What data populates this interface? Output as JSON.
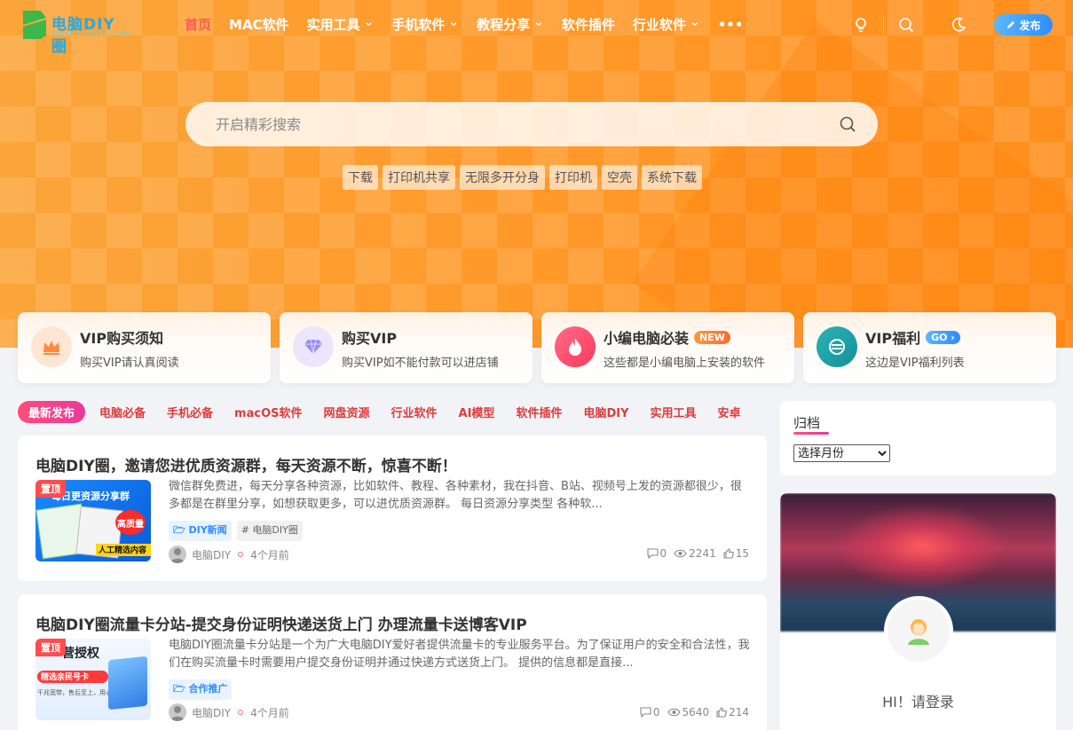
{
  "brand": {
    "name": "电脑DIY圈",
    "tagline": "WWW.DIYQUAN.COM",
    "green": "#3cb84a",
    "blue": "#2aa9e0"
  },
  "nav": {
    "items": [
      {
        "label": "首页",
        "active": true,
        "dropdown": false
      },
      {
        "label": "MAC软件",
        "active": false,
        "dropdown": false
      },
      {
        "label": "实用工具",
        "active": false,
        "dropdown": true
      },
      {
        "label": "手机软件",
        "active": false,
        "dropdown": true
      },
      {
        "label": "教程分享",
        "active": false,
        "dropdown": true
      },
      {
        "label": "软件插件",
        "active": false,
        "dropdown": false
      },
      {
        "label": "行业软件",
        "active": false,
        "dropdown": true
      },
      {
        "label": "•••",
        "active": false,
        "dropdown": false
      }
    ],
    "icons": [
      "bulb-icon",
      "search-icon",
      "moon-icon"
    ],
    "publish_label": "发布",
    "active_color": "#ff5a5a"
  },
  "search": {
    "placeholder": "开启精彩搜索",
    "hot_tags": [
      "下载",
      "打印机共享",
      "无限多开分身",
      "打印机",
      "空壳",
      "系统下载"
    ]
  },
  "features": [
    {
      "title": "VIP购买须知",
      "desc": "购买VIP请认真阅读",
      "icon": "crown-icon",
      "badge": ""
    },
    {
      "title": "购买VIP",
      "desc": "购买VIP如不能付款可以进店铺",
      "icon": "diamond-icon",
      "badge": ""
    },
    {
      "title": "小编电脑必装",
      "desc": "这些都是小编电脑上安装的软件",
      "icon": "flame-icon",
      "badge": "NEW"
    },
    {
      "title": "VIP福利",
      "desc": "这边是VIP福利列表",
      "icon": "gift-icon",
      "badge": "GO"
    }
  ],
  "categories": [
    "最新发布",
    "电脑必备",
    "手机必备",
    "macOS软件",
    "网盘资源",
    "行业软件",
    "AI模型",
    "软件插件",
    "电脑DIY",
    "实用工具",
    "安卓"
  ],
  "posts": [
    {
      "title": "电脑DIY圈，邀请您进优质资源群，每天资源不断，惊喜不断！",
      "pin": "置顶",
      "thumb_text": "每日更资源分享群",
      "thumb_badge": "高质量",
      "thumb_footer": "人工精选内容",
      "excerpt": "微信群免费进，每天分享各种资源，比如软件、教程、各种素材，我在抖音、B站、视频号上发的资源都很少，很多都是在群里分享，如想获取更多，可以进优质资源群。   每日资源分享类型 各种软...",
      "tags": [
        {
          "label": "DIY新闻",
          "style": "blue",
          "icon": "folder-icon"
        },
        {
          "label": "电脑DIY圈",
          "style": "gray",
          "icon": "hash-icon"
        }
      ],
      "author": "电脑DIY",
      "time": "4个月前",
      "comments": "0",
      "views": "2241",
      "likes": "15"
    },
    {
      "title": "电脑DIY圈流量卡分站-提交身份证明快递送货上门 办理流量卡送博客VIP",
      "pin": "置顶",
      "thumb_text": "营授权",
      "thumb_badge": "精选亲民号卡",
      "thumb_footer": "千兆宽带，售后至上，用心做好服务",
      "excerpt": "电脑DIY圈流量卡分站是一个为广大电脑DIY爱好者提供流量卡的专业服务平台。为了保证用户的安全和合法性，我们在购买流量卡时需要用户提交身份证明并通过快递方式送货上门。 提供的信息都是直接...",
      "tags": [
        {
          "label": "合作推广",
          "style": "blue",
          "icon": "folder-icon"
        }
      ],
      "author": "电脑DIY",
      "time": "4个月前",
      "comments": "0",
      "views": "5640",
      "likes": "214"
    }
  ],
  "sidebar": {
    "archive_title": "归档",
    "month_select": "选择月份",
    "login_text": "HI！请登录"
  }
}
